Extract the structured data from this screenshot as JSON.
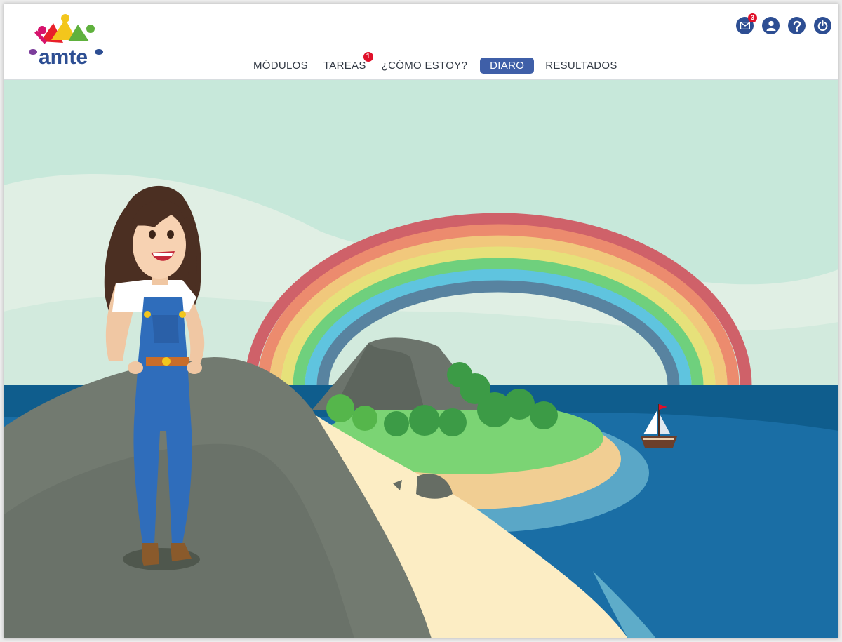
{
  "app": {
    "logo_text": "amte"
  },
  "nav": {
    "items": [
      {
        "label": "MÓDULOS",
        "active": false
      },
      {
        "label": "TAREAS",
        "active": false,
        "badge": "1"
      },
      {
        "label": "¿CÓMO ESTOY?",
        "active": false
      },
      {
        "label": "DIARO",
        "active": true
      },
      {
        "label": "RESULTADOS",
        "active": false
      }
    ]
  },
  "top_icons": {
    "mail": {
      "icon": "mail-icon",
      "badge": "3"
    },
    "profile": {
      "icon": "user-icon"
    },
    "help": {
      "icon": "help-icon"
    },
    "logout": {
      "icon": "power-icon"
    }
  },
  "colors": {
    "brand": "#2d4e93",
    "nav_active": "#3f5fa8",
    "badge": "#e0102a",
    "sky": "#c7e8da",
    "sea": "#1d74a8"
  }
}
